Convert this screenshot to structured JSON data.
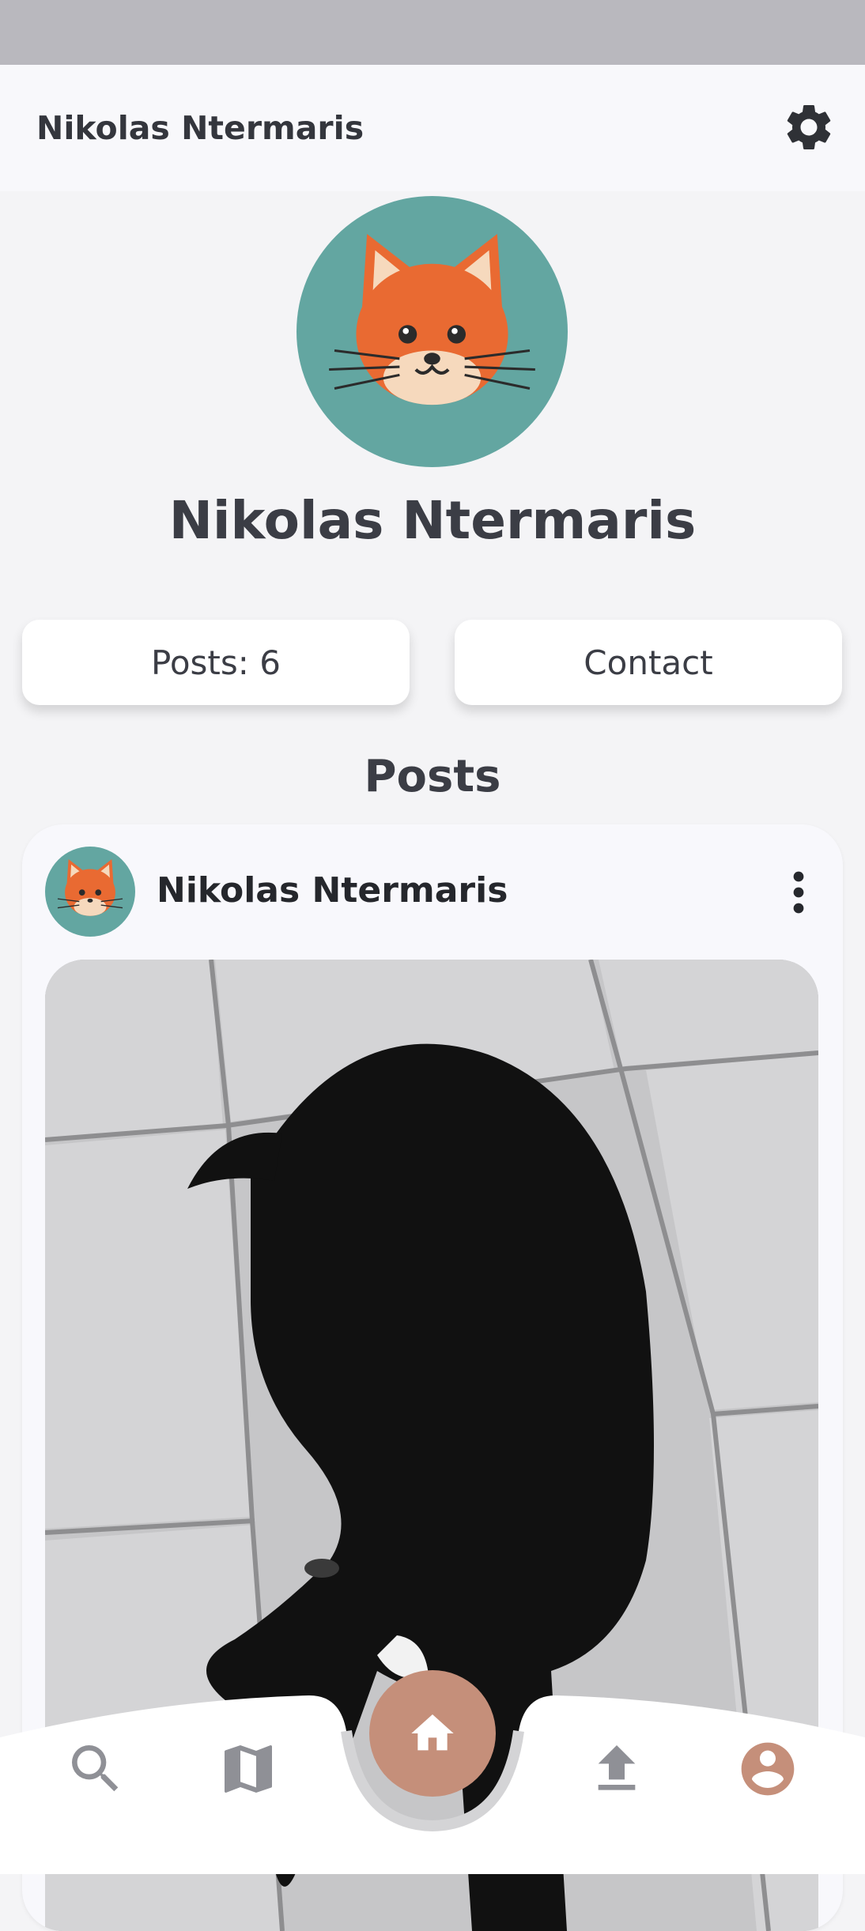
{
  "app_bar": {
    "title": "Nikolas Ntermaris",
    "settings_icon": "gear-icon"
  },
  "profile": {
    "name": "Nikolas Ntermaris",
    "avatar_icon": "cat-avatar"
  },
  "stats": {
    "posts_label": "Posts: 6",
    "contact_label": "Contact"
  },
  "posts_section": {
    "heading": "Posts",
    "items": [
      {
        "author": "Nikolas Ntermaris",
        "menu_icon": "more-vertical-icon",
        "image_subject": "black dog lying on pavement"
      }
    ]
  },
  "bottom_nav": {
    "items": [
      {
        "icon": "search-icon",
        "active": false
      },
      {
        "icon": "map-icon",
        "active": false
      },
      {
        "icon": "home-icon",
        "active": false
      },
      {
        "icon": "upload-icon",
        "active": false
      },
      {
        "icon": "profile-icon",
        "active": true
      }
    ]
  },
  "colors": {
    "accent": "#c58f7a",
    "avatar_bg": "#63a6a1",
    "text_dark": "#3b3d45",
    "nav_inactive": "#8f9096",
    "background": "#f4f4f6"
  }
}
